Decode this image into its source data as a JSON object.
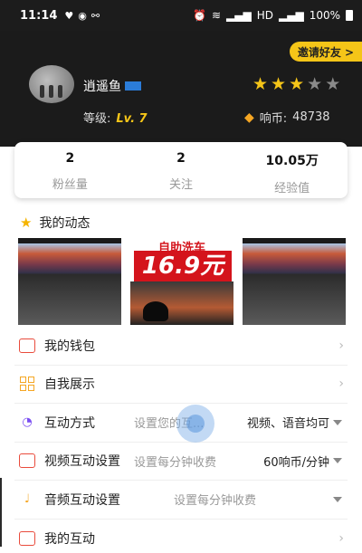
{
  "status": {
    "time": "11:14",
    "network_label": "HD",
    "battery": "100%"
  },
  "colors": {
    "accent": "#f5c518",
    "header_bg": "#1b1b1b"
  },
  "header": {
    "invite_label": "邀请好友 >",
    "username": "逍遥鱼",
    "rating_filled": 3,
    "rating_total": 5,
    "level_label": "等级:",
    "level_value": "Lv. 7",
    "coin_label": "响币:",
    "coin_value": "48738"
  },
  "stats": [
    {
      "value": "2",
      "label": "粉丝量"
    },
    {
      "value": "2",
      "label": "关注"
    },
    {
      "value": "10.05万",
      "label": "经验值"
    }
  ],
  "dynamic": {
    "title": "我的动态",
    "promo_headline": "自助洗车",
    "promo_price": "16.9元"
  },
  "menu": [
    {
      "label": "我的钱包",
      "icon": "wallet-icon"
    },
    {
      "label": "自我展示",
      "icon": "grid-icon"
    },
    {
      "label": "互动方式",
      "placeholder": "设置您的互...",
      "value": "视频、语音均可",
      "icon": "interaction-mode-icon"
    },
    {
      "label": "视频互动设置",
      "placeholder": "设置每分钟收费",
      "value": "60响币/分钟",
      "icon": "video-icon"
    },
    {
      "label": "音频互动设置",
      "placeholder": "设置每分钟收费",
      "value": "",
      "icon": "audio-icon"
    },
    {
      "label": "我的互动",
      "icon": "interaction-icon"
    }
  ]
}
